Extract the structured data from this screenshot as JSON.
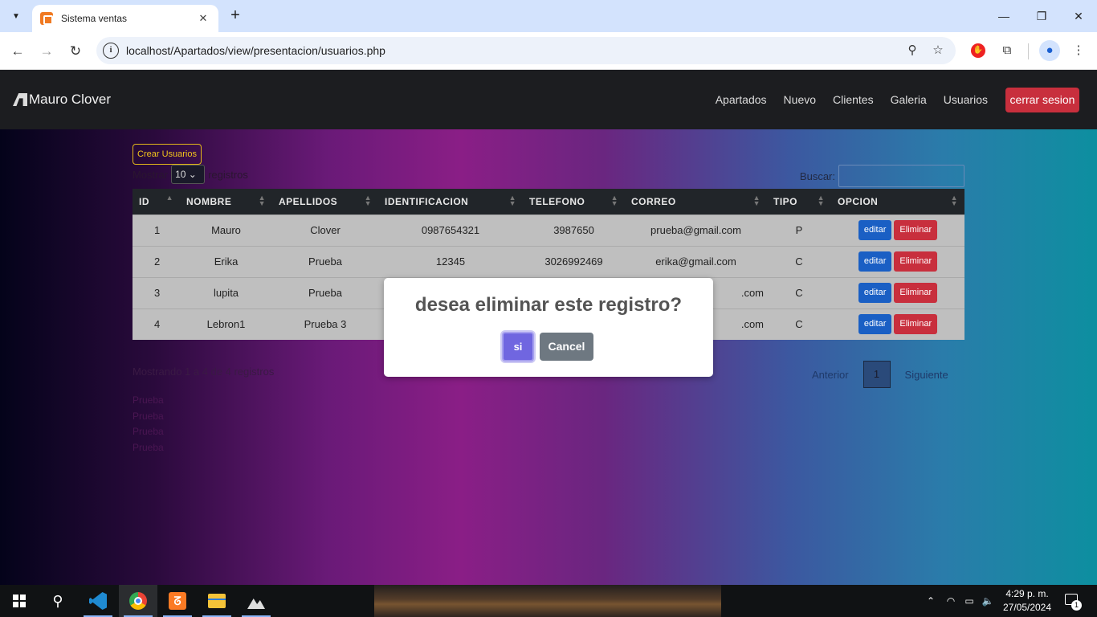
{
  "browser": {
    "tab_title": "Sistema ventas",
    "url": "localhost/Apartados/view/presentacion/usuarios.php"
  },
  "navbar": {
    "brand": "Mauro Clover",
    "links": [
      "Apartados",
      "Nuevo",
      "Clientes",
      "Galeria",
      "Usuarios"
    ],
    "logout_label": "cerrar sesion"
  },
  "toolbar": {
    "create_label": "Crear Usuarios",
    "length_prefix": "Mostrar",
    "length_value": "10",
    "length_suffix": "registros",
    "search_label": "Buscar:"
  },
  "table": {
    "headers": [
      "ID",
      "NOMBRE",
      "APELLIDOS",
      "IDENTIFICACION",
      "TELEFONO",
      "CORREO",
      "TIPO",
      "OPCION"
    ],
    "rows": [
      [
        "1",
        "Mauro",
        "Clover",
        "0987654321",
        "3987650",
        "prueba@gmail.com",
        "P"
      ],
      [
        "2",
        "Erika",
        "Prueba",
        "12345",
        "3026992469",
        "erika@gmail.com",
        "C"
      ],
      [
        "3",
        "lupita",
        "Prueba",
        "",
        "",
        ".com",
        "C"
      ],
      [
        "4",
        "Lebron1",
        "Prueba 3",
        "",
        "",
        ".com",
        "C"
      ]
    ],
    "edit_label": "editar",
    "delete_label": "Eliminar"
  },
  "footer": {
    "info": "Mostrando 1 a 4 de 4 registros",
    "prev_label": "Anterior",
    "page": "1",
    "next_label": "Siguiente",
    "leftover_lines": [
      "Prueba",
      "Prueba",
      "Prueba",
      "Prueba"
    ]
  },
  "dialog": {
    "title": "desea eliminar este registro?",
    "confirm_label": "si",
    "cancel_label": "Cancel"
  },
  "taskbar": {
    "time": "4:29 p. m.",
    "date": "27/05/2024",
    "notification_count": "1"
  },
  "colors": {
    "danger": "#c82f3d",
    "primary": "#1a5fc4",
    "confirm": "#7066e0",
    "cancel": "#6e7881",
    "warning_outline": "#f0c31c"
  }
}
